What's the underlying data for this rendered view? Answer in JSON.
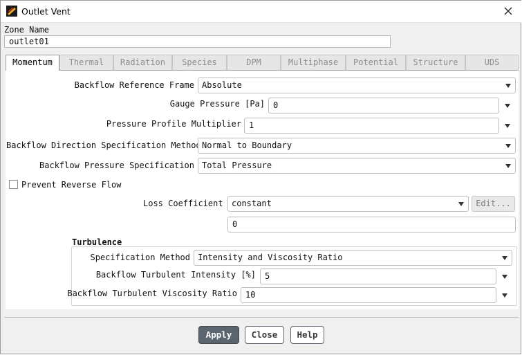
{
  "window": {
    "title": "Outlet Vent",
    "icon": "app-icon",
    "close_icon": "close-icon"
  },
  "zone": {
    "label": "Zone Name",
    "value": "outlet01"
  },
  "tabs": [
    {
      "label": "Momentum",
      "active": true
    },
    {
      "label": "Thermal"
    },
    {
      "label": "Radiation"
    },
    {
      "label": "Species"
    },
    {
      "label": "DPM"
    },
    {
      "label": "Multiphase"
    },
    {
      "label": "Potential"
    },
    {
      "label": "Structure"
    },
    {
      "label": "UDS"
    }
  ],
  "momentum": {
    "backflow_ref_frame": {
      "label": "Backflow Reference Frame",
      "value": "Absolute"
    },
    "gauge_pressure": {
      "label": "Gauge Pressure [Pa]",
      "value": "0"
    },
    "pressure_profile_multiplier": {
      "label": "Pressure Profile Multiplier",
      "value": "1"
    },
    "backflow_direction": {
      "label": "Backflow Direction Specification Method",
      "value": "Normal to Boundary"
    },
    "backflow_pressure": {
      "label": "Backflow Pressure Specification",
      "value": "Total Pressure"
    },
    "prevent_reverse_flow": {
      "label": "Prevent Reverse Flow",
      "checked": false
    },
    "loss_coefficient": {
      "label": "Loss Coefficient",
      "method": "constant",
      "edit_label": "Edit...",
      "value": "0"
    }
  },
  "turbulence": {
    "heading": "Turbulence",
    "spec_method": {
      "label": "Specification Method",
      "value": "Intensity and Viscosity Ratio"
    },
    "intensity": {
      "label": "Backflow Turbulent Intensity [%]",
      "value": "5"
    },
    "viscosity_ratio": {
      "label": "Backflow Turbulent Viscosity Ratio",
      "value": "10"
    }
  },
  "buttons": {
    "apply": "Apply",
    "close": "Close",
    "help": "Help"
  }
}
